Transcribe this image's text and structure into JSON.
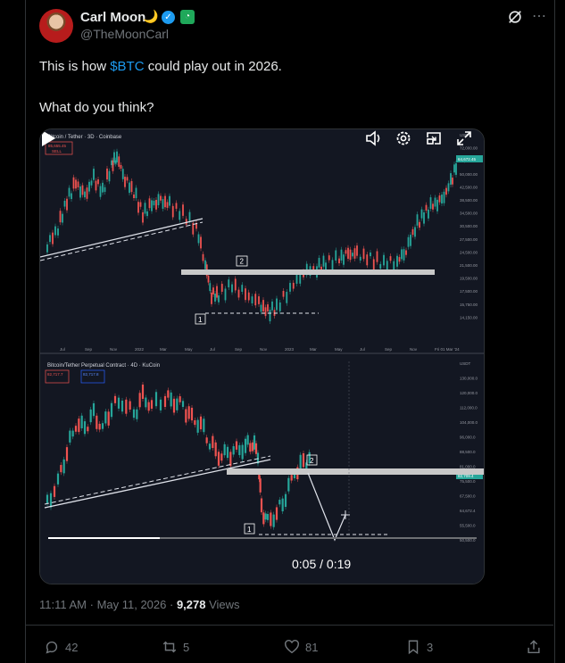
{
  "author": {
    "name": "Carl Moon",
    "handle": "@TheMoonCarl",
    "emoji": "🌙"
  },
  "tweet": {
    "text_before": "This is how ",
    "cashtag": "$BTC",
    "text_after": " could play out in 2026.",
    "question": "What do you think?"
  },
  "video": {
    "time_current": "0:05",
    "time_separator": " / ",
    "time_total": "0:19",
    "progress": 0.26
  },
  "chart_top": {
    "title": "Bitcoin / Tether · 3D · Coinbase",
    "price_box": "85,655.45",
    "sell": "SELL",
    "y_ticks": [
      "USDT",
      "72,000.00",
      "58,000.00",
      "50,000.00",
      "42,500.00",
      "38,500.00",
      "34,500.00",
      "30,500.00",
      "27,500.00",
      "24,500.00",
      "21,500.00",
      "19,500.00",
      "17,500.00",
      "15,750.00",
      "14,150.00"
    ],
    "x_ticks": [
      "Jul",
      "Sep",
      "Nov",
      "2022",
      "Mar",
      "May",
      "Jul",
      "Sep",
      "Nov",
      "2023",
      "Mar",
      "May",
      "Jul",
      "Sep",
      "Nov",
      "Fri 01 Mar '24"
    ],
    "current_price": "64,672.45",
    "label_1": "1",
    "label_2": "2"
  },
  "chart_bottom": {
    "title": "Bitcoin/Tether Perpetual Contract · 4D · KuCoin",
    "price_sell": "82,717.7",
    "price_buy": "82,717.8",
    "y_ticks": [
      "USDT",
      "130,000.0",
      "120,000.0",
      "112,000.0",
      "104,000.0",
      "96,000.0",
      "88,500.0",
      "81,000.0",
      "75,500.0",
      "67,500.0",
      "64,672.4",
      "55,500.0",
      "50,500.0"
    ],
    "current_price": "82,709.4",
    "label_1": "1",
    "label_2": "2"
  },
  "footer": {
    "time": "11:11 AM",
    "dot": " · ",
    "date": "May 11, 2026",
    "views_count": "9,278",
    "views_label": " Views"
  },
  "actions": {
    "replies": "42",
    "reposts": "5",
    "likes": "81",
    "bookmarks": "3"
  },
  "colors": {
    "accent": "#1d9bf0",
    "up": "#26a69a",
    "down": "#ef5350",
    "zone": "#c8c8c8"
  }
}
